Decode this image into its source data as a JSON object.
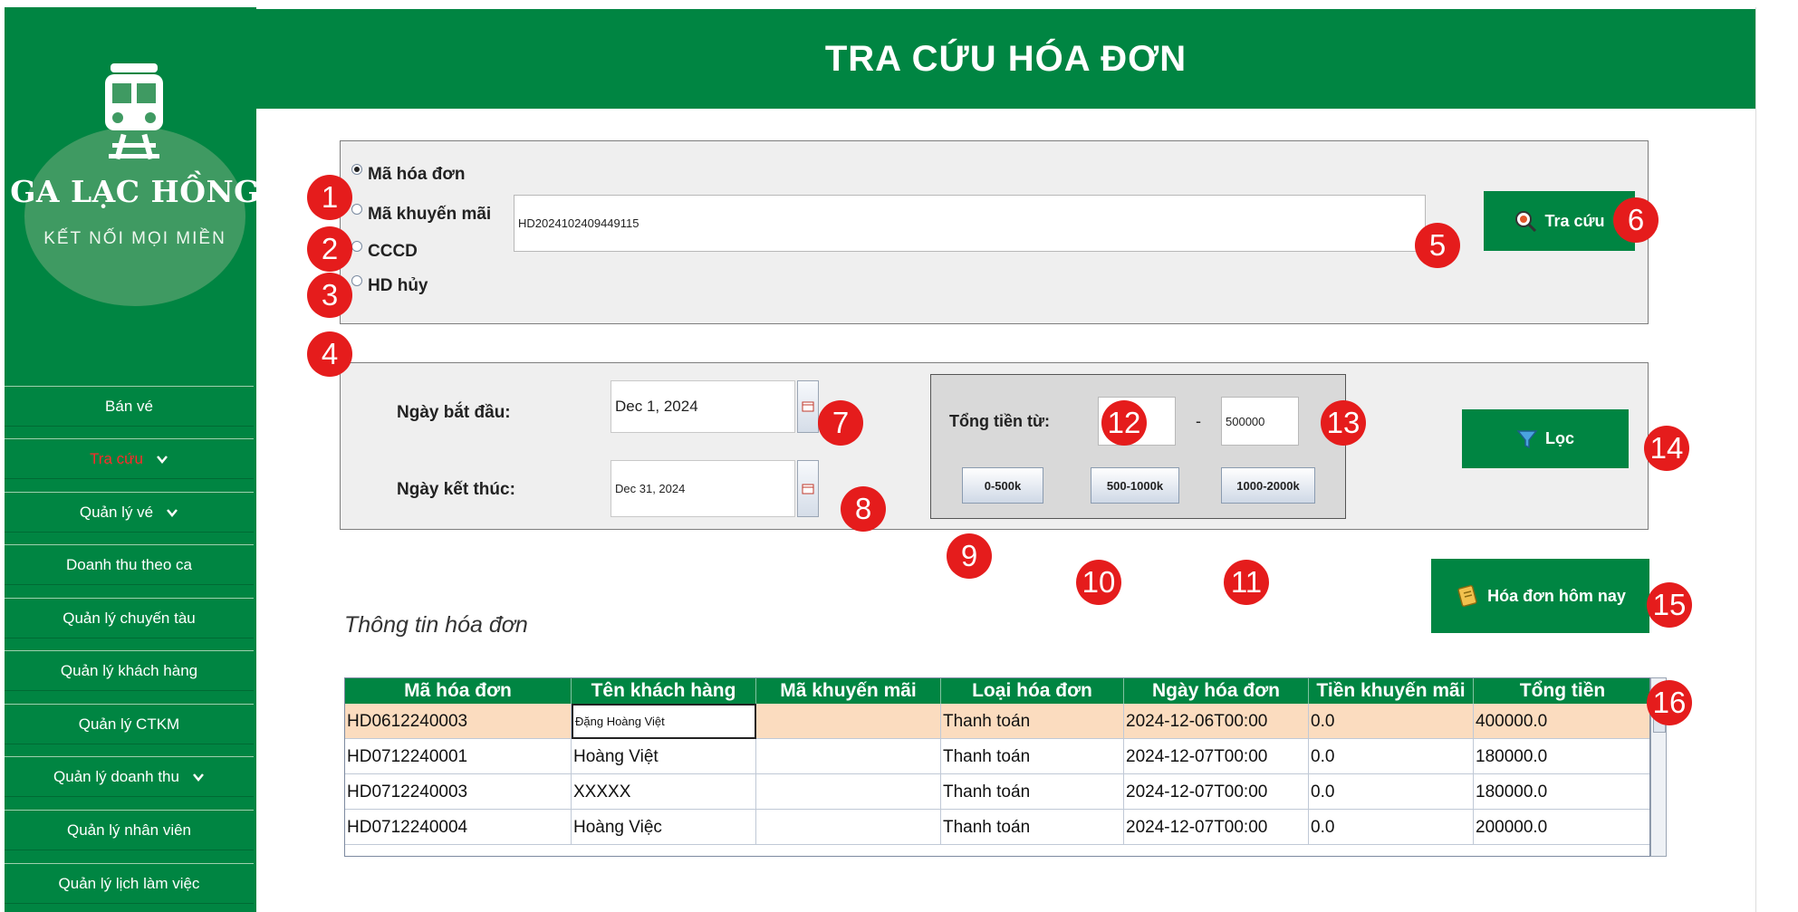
{
  "header": {
    "title": "TRA CỨU HÓA ĐƠN"
  },
  "logo": {
    "title": "GA LẠC HỒNG",
    "subtitle": "KẾT NỐI MỌI MIỀN",
    "icon": "train-icon"
  },
  "sidebar": {
    "items": [
      {
        "label": "Bán vé"
      },
      {
        "label": "Tra cứu",
        "active": true,
        "dropdown": true
      },
      {
        "label": "Quản lý vé",
        "dropdown": true
      },
      {
        "label": "Doanh thu theo ca"
      },
      {
        "label": "Quản lý chuyến tàu"
      },
      {
        "label": "Quản lý khách hàng"
      },
      {
        "label": "Quản lý CTKM"
      },
      {
        "label": "Quản lý doanh thu",
        "dropdown": true
      },
      {
        "label": "Quản lý nhân viên"
      },
      {
        "label": "Quản lý lịch làm việc"
      }
    ]
  },
  "search": {
    "options": [
      "Mã hóa đơn",
      "Mã khuyến mãi",
      "CCCD",
      "HD hủy"
    ],
    "selected": "Mã hóa đơn",
    "value": "HD2024102409449115",
    "button_label": "Tra cứu"
  },
  "filter": {
    "start_label": "Ngày bắt đầu:",
    "start_value": "Dec 1, 2024",
    "end_label": "Ngày kết thúc:",
    "end_value": "Dec 31, 2024",
    "total_label": "Tổng tiền từ:",
    "total_from": "",
    "total_separator": "-",
    "total_to": "500000",
    "presets": [
      "0-500k",
      "500-1000k",
      "1000-2000k"
    ],
    "button_label": "Lọc"
  },
  "today_button_label": "Hóa đơn hôm nay",
  "badges": [
    "1",
    "2",
    "3",
    "4",
    "5",
    "6",
    "7",
    "8",
    "9",
    "10",
    "11",
    "12",
    "13",
    "14",
    "15",
    "16"
  ],
  "table": {
    "title": "Thông tin hóa đơn",
    "columns": [
      "Mã hóa đơn",
      "Tên khách hàng",
      "Mã khuyến mãi",
      "Loại hóa đơn",
      "Ngày hóa đơn",
      "Tiền khuyến mãi",
      "Tổng tiền"
    ],
    "rows": [
      [
        "HD0612240003",
        "Đặng Hoàng Việt",
        "",
        "Thanh toán",
        "2024-12-06T00:00",
        "0.0",
        "400000.0"
      ],
      [
        "HD0712240001",
        "Hoàng Việt",
        "",
        "Thanh toán",
        "2024-12-07T00:00",
        "0.0",
        "180000.0"
      ],
      [
        "HD0712240003",
        "XXXXX",
        "",
        "Thanh toán",
        "2024-12-07T00:00",
        "0.0",
        "180000.0"
      ],
      [
        "HD0712240004",
        "Hoàng Việc",
        "",
        "Thanh toán",
        "2024-12-07T00:00",
        "0.0",
        "200000.0"
      ]
    ],
    "selected_row": 0
  },
  "colors": {
    "brand_green": "#008542",
    "badge_red": "#e51c1c",
    "selected_row": "#fbdcbf",
    "active_nav": "#ff2a2a"
  }
}
